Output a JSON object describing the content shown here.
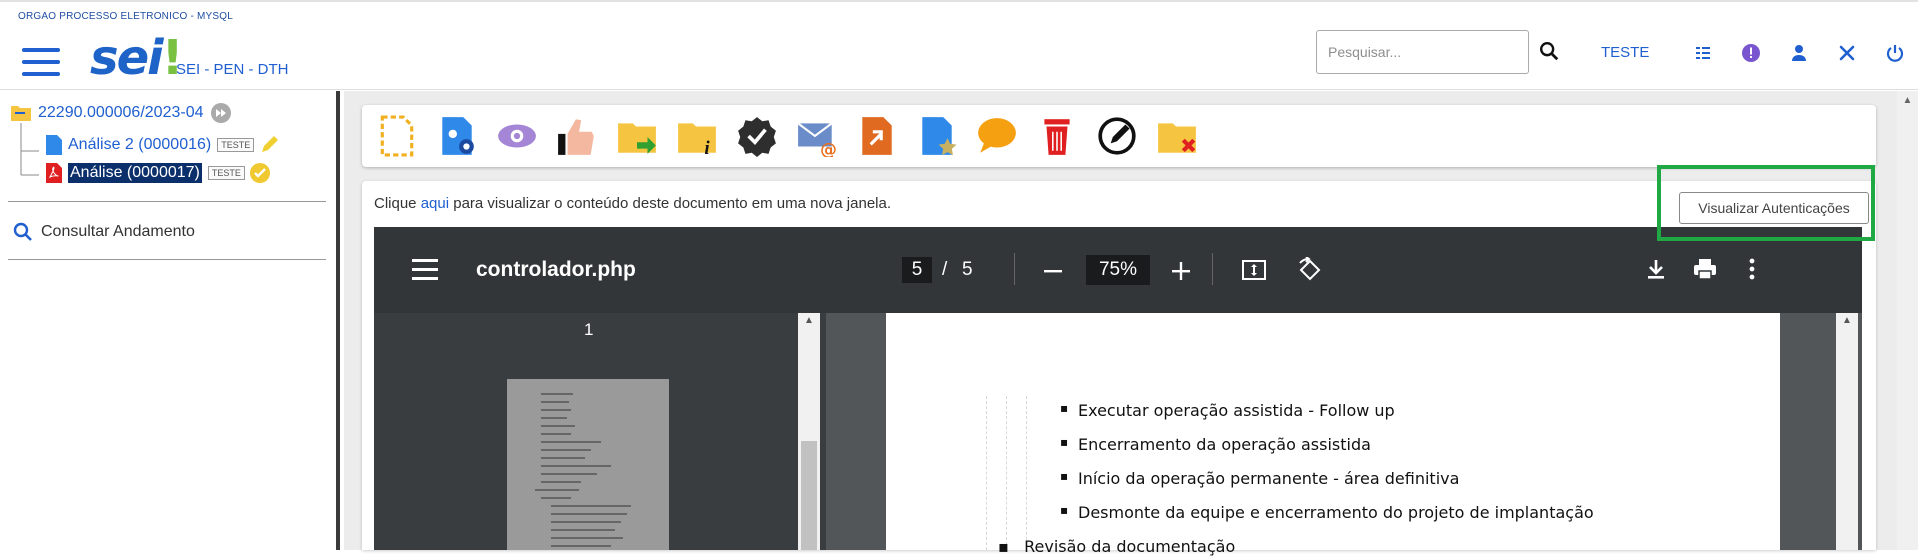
{
  "header": {
    "org": "ORGAO PROCESSO ELETRONICO - MYSQL",
    "logo_main": "sei",
    "logo_mark": "!",
    "unit": "SEI - PEN - DTH",
    "search_placeholder": "Pesquisar...",
    "user_unit": "TESTE"
  },
  "sidebar": {
    "process": "22290.000006/2023-04",
    "docs": [
      {
        "label": "Análise 2 (0000016)",
        "badge": "TESTE"
      },
      {
        "label": "Análise (0000017)",
        "badge": "TESTE"
      }
    ],
    "consult": "Consultar Andamento"
  },
  "document": {
    "msg_prefix": "Clique ",
    "msg_link": "aqui",
    "msg_suffix": " para visualizar o conteúdo deste documento em uma nova janela.",
    "auth_button": "Visualizar Autenticações"
  },
  "pdf": {
    "filename": "controlador.php",
    "page_current": "5",
    "page_sep": "/",
    "page_total": "5",
    "zoom": "75%",
    "thumb_number": "1",
    "bullets": [
      "Executar operação assistida - Follow up",
      "Encerramento da operação assistida",
      "Início da operação permanente - área definitiva",
      "Desmonte da equipe e encerramento do projeto de implantação"
    ],
    "cut_line": "Revisão da documentação"
  },
  "colors": {
    "brand": "#1e63c8",
    "accent_green": "#20a845",
    "pdf_toolbar": "#323639"
  }
}
